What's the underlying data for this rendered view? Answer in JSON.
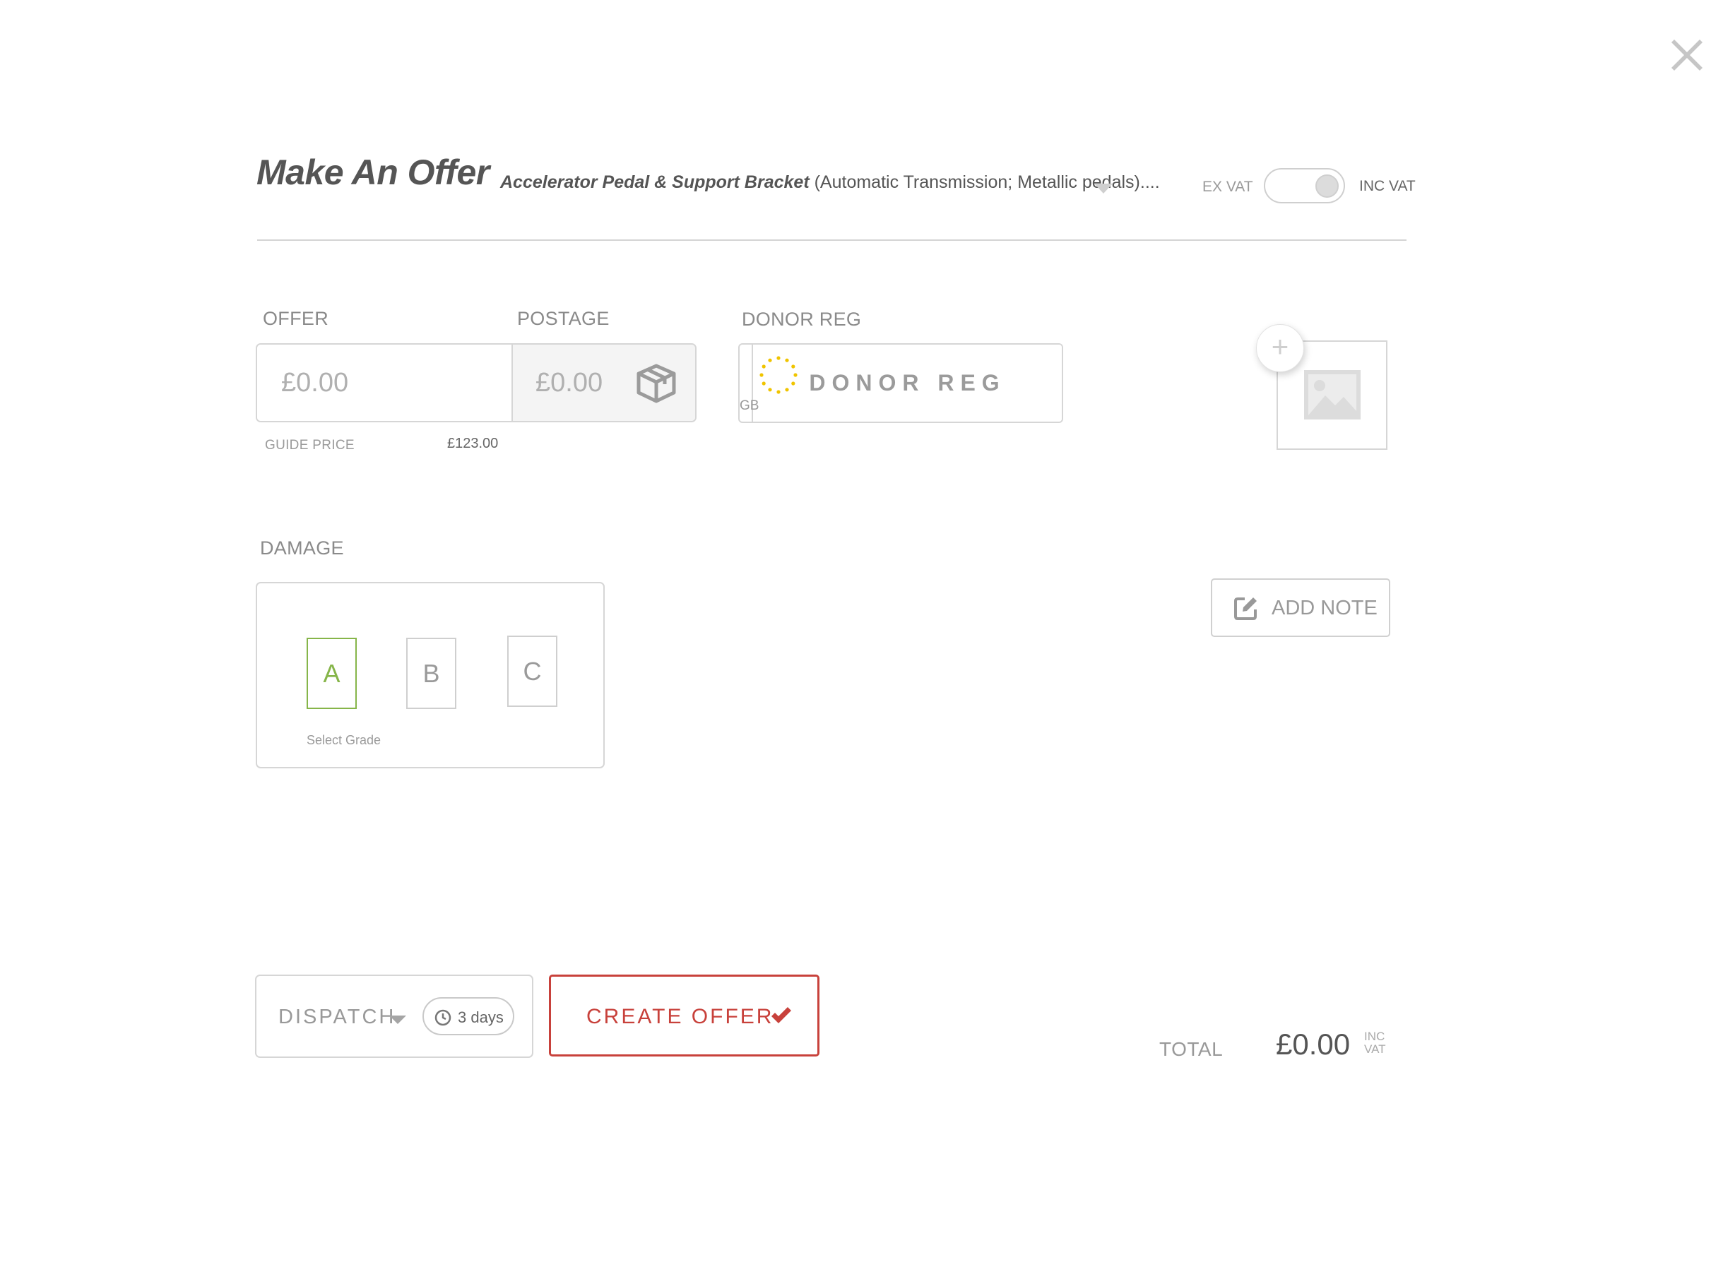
{
  "close": {
    "icon": "close-icon"
  },
  "header": {
    "title": "Make An Offer",
    "product_name": "Accelerator Pedal & Support Bracket",
    "product_desc": " (Automatic Transmission; Metallic pedals)....",
    "vat_left": "EX VAT",
    "vat_right": "INC VAT",
    "vat_mode": "INC VAT"
  },
  "offer": {
    "label": "OFFER",
    "placeholder": "£0.00",
    "guide_label": "GUIDE PRICE",
    "guide_value": "£123.00"
  },
  "postage": {
    "label": "POSTAGE",
    "placeholder": "£0.00",
    "icon": "box-icon"
  },
  "donor": {
    "label": "DONOR REG",
    "country": "GB",
    "placeholder": "DONOR REG"
  },
  "image_upload": {
    "add_icon": "plus-icon",
    "placeholder_icon": "image-icon"
  },
  "damage": {
    "label": "DAMAGE",
    "grades": [
      "A",
      "B",
      "C"
    ],
    "selected": "A",
    "hint": "Select Grade"
  },
  "note": {
    "label": "ADD NOTE",
    "icon": "edit-icon"
  },
  "dispatch": {
    "label": "DISPATCH",
    "days": "3 days"
  },
  "create": {
    "label": "CREATE OFFER",
    "icon": "check-icon"
  },
  "total": {
    "label": "TOTAL",
    "value": "£0.00",
    "vat_line1": "INC",
    "vat_line2": "VAT"
  },
  "colors": {
    "accent": "#c8413b",
    "grade_selected": "#86b549",
    "border": "#d6d6d6"
  }
}
